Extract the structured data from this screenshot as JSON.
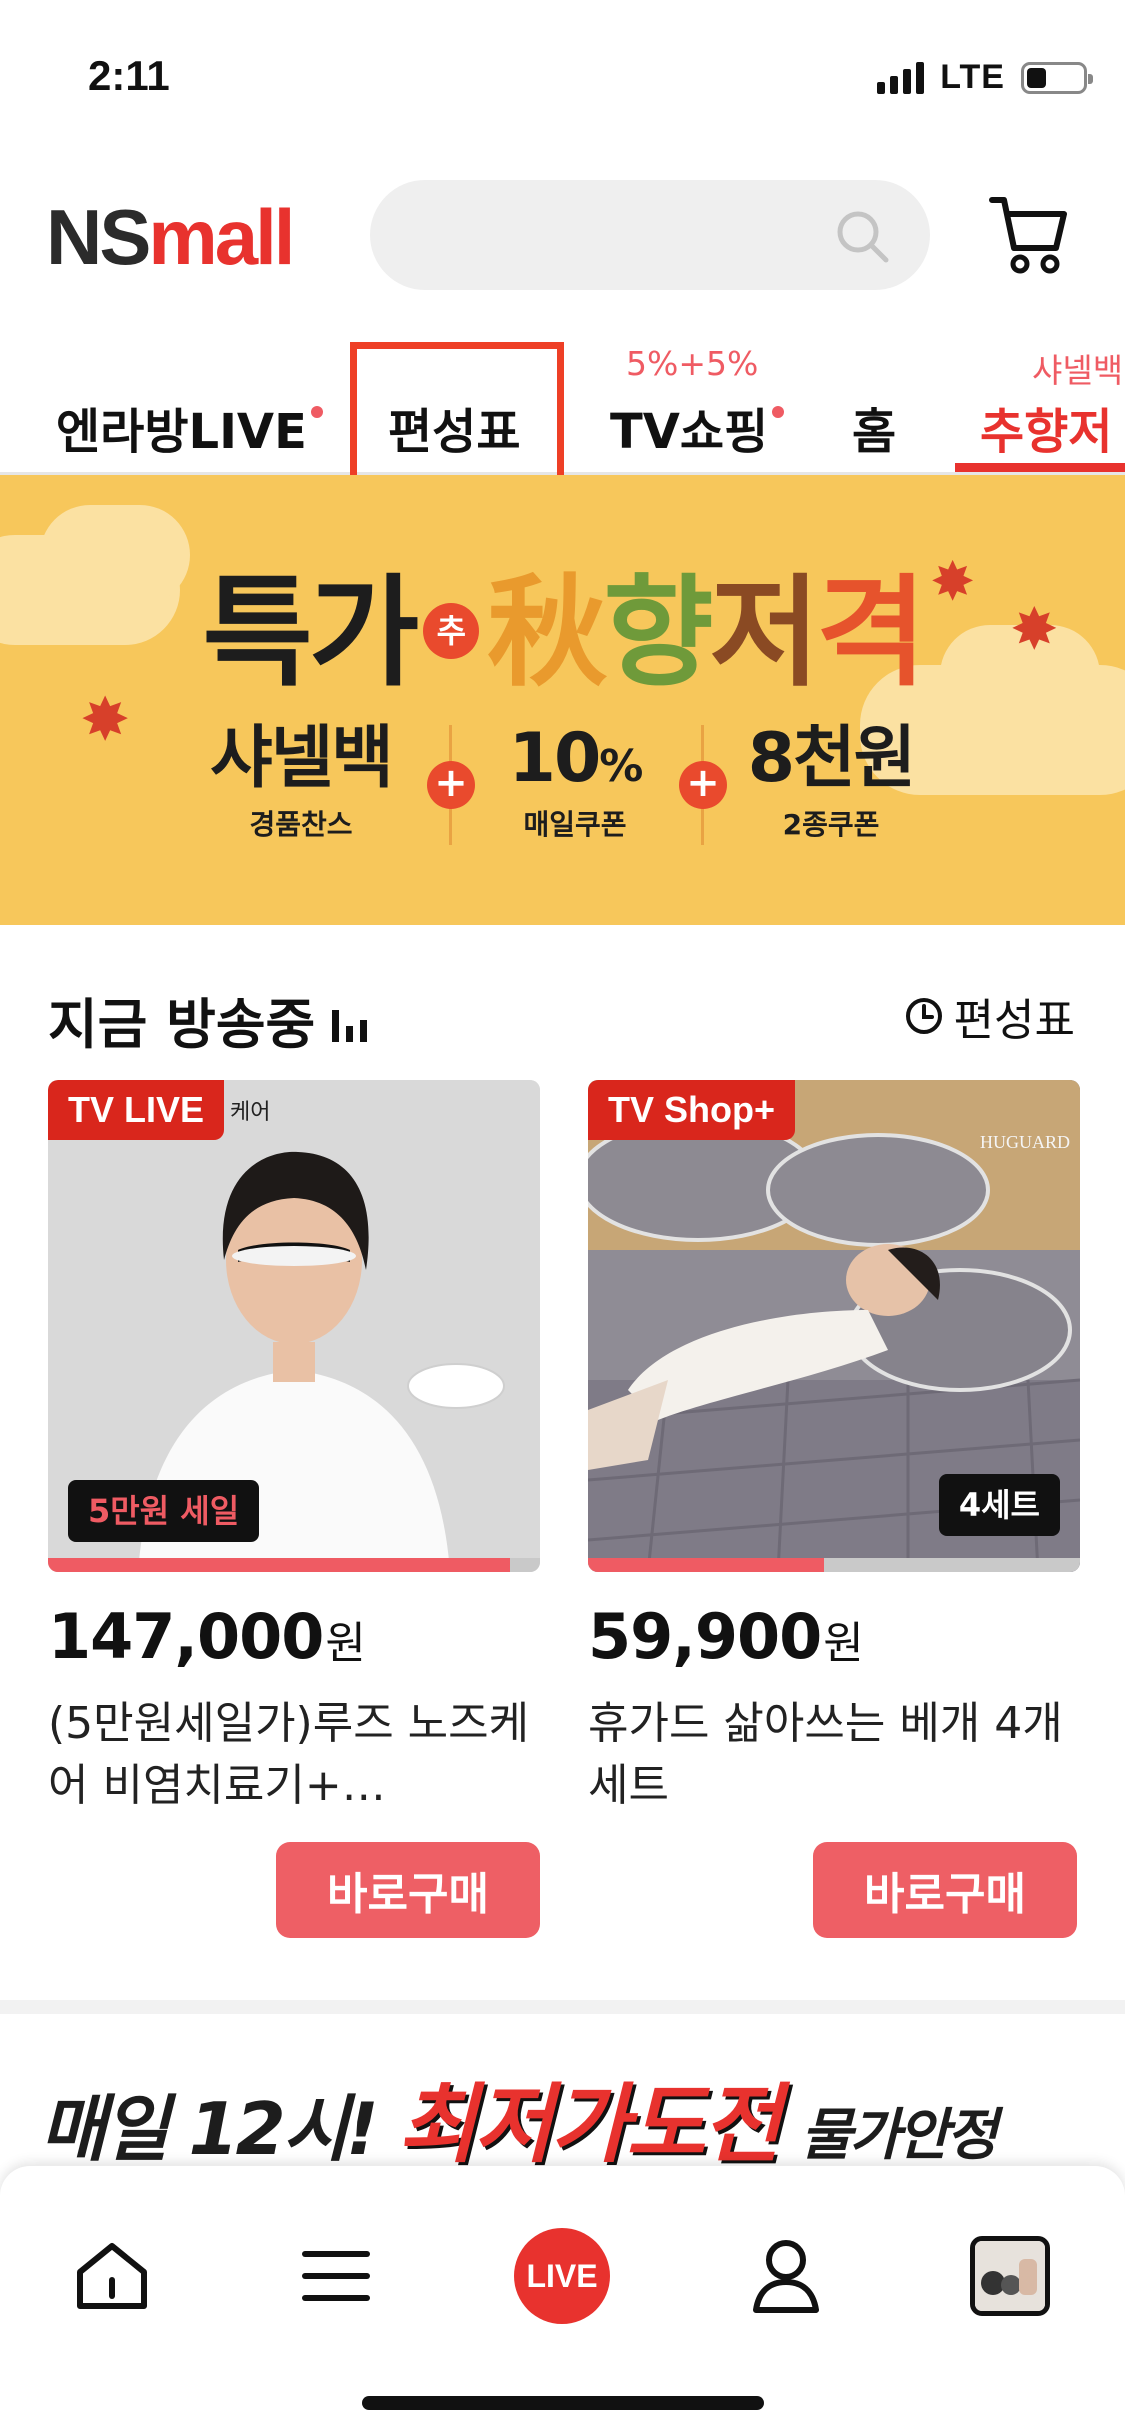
{
  "status_bar": {
    "time": "2:11",
    "network": "LTE",
    "battery_level": 0.35
  },
  "header": {
    "logo_ns": "NS",
    "logo_mall": "mall",
    "search": {
      "placeholder": ""
    },
    "icons": {
      "search": "search-icon",
      "cart": "cart-icon"
    }
  },
  "nav": {
    "tabs": [
      {
        "label": "엔라방LIVE",
        "dot": true,
        "super": ""
      },
      {
        "label": "편성표",
        "dot": false,
        "super": "",
        "highlighted": true
      },
      {
        "label": "TV쇼핑",
        "dot": true,
        "super": "5%+5%"
      },
      {
        "label": "홈",
        "dot": false,
        "super": ""
      },
      {
        "label": "추향저",
        "dot": false,
        "super": "샤넬백",
        "active": true
      }
    ]
  },
  "banner": {
    "title_part1": "특가",
    "title_chu": "추",
    "title_part2_chars": [
      "秋",
      "향",
      "저",
      "격"
    ],
    "promos": [
      {
        "main": "샤넬백",
        "sub": "경품찬스"
      },
      {
        "main": "10",
        "unit": "%",
        "sub": "매일쿠폰"
      },
      {
        "main": "8천원",
        "sub": "2종쿠폰"
      }
    ],
    "plus": "+"
  },
  "section": {
    "title": "지금 방송중",
    "schedule_link": "편성표"
  },
  "products": [
    {
      "badge": "TV LIVE",
      "image_caption": "케어",
      "tag": "5만원 세일",
      "tag_color": "#ef5b63",
      "progress": 0.94,
      "price": "147,000",
      "currency": "원",
      "name": "(5만원세일가)루즈 노즈케어 비염치료기+…",
      "buy_label": "바로구매"
    },
    {
      "badge": "TV Shop+",
      "image_caption": "HUGUARD",
      "tag": "4세트",
      "tag_color": "#ffffff",
      "progress": 0.48,
      "price": "59,900",
      "currency": "원",
      "name": "휴가드 삶아쓰는 베개 4개세트",
      "buy_label": "바로구매"
    }
  ],
  "promo_strip": {
    "part1": "매일 12시!",
    "part2": "최저가도전",
    "part3": "물가안정"
  },
  "bottom_nav": {
    "items": [
      "home-icon",
      "menu-icon",
      "live-button",
      "my-page-icon",
      "recent-product-thumbnail"
    ],
    "live_label": "LIVE"
  },
  "colors": {
    "brand_red": "#e8322e",
    "buy_button": "#ee5f65",
    "banner_bg": "#f7c75b",
    "highlight_box": "#ee3f26"
  }
}
